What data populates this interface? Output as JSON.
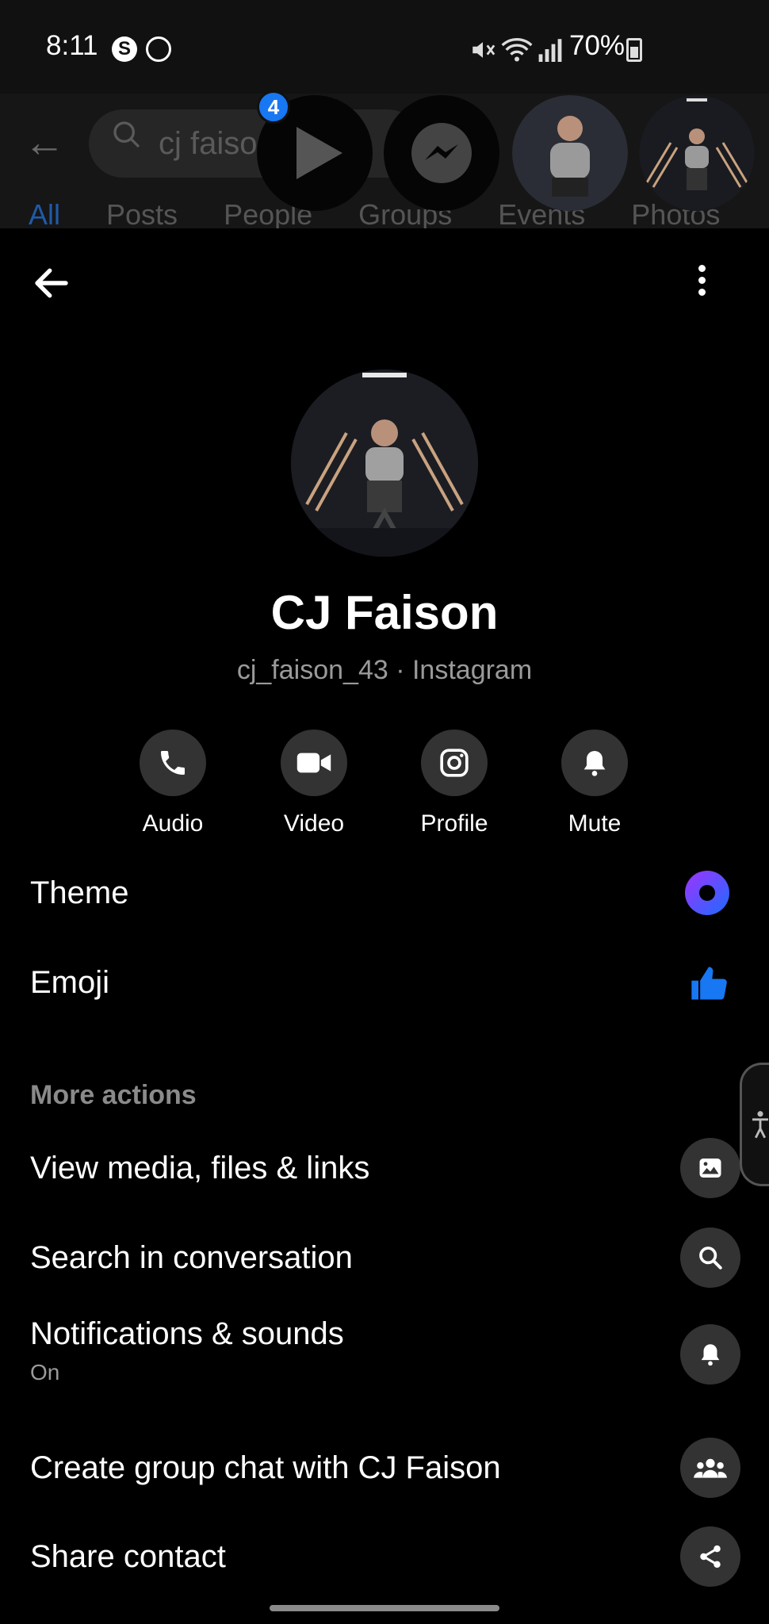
{
  "status_bar": {
    "time": "8:11",
    "battery": "70%",
    "app_icons": [
      "s-icon",
      "messenger-icon"
    ]
  },
  "background": {
    "search_text": "cj faiso",
    "tabs": [
      "All",
      "Posts",
      "People",
      "Groups",
      "Events",
      "Photos"
    ],
    "notification_badge": "4"
  },
  "header": {
    "back_icon": "back-arrow-icon",
    "more_icon": "more-vertical-icon"
  },
  "profile": {
    "name": "CJ Faison",
    "subtitle": "cj_faison_43 · Instagram"
  },
  "actions": [
    {
      "label": "Audio",
      "icon": "phone-icon"
    },
    {
      "label": "Video",
      "icon": "video-camera-icon"
    },
    {
      "label": "Profile",
      "icon": "instagram-icon"
    },
    {
      "label": "Mute",
      "icon": "bell-icon"
    }
  ],
  "settings": {
    "theme_label": "Theme",
    "theme_color": "#7b3cff",
    "emoji_label": "Emoji",
    "emoji_icon": "thumbs-up-icon",
    "emoji_color": "#1877f2"
  },
  "more_actions": {
    "title": "More actions",
    "items": [
      {
        "label": "View media, files & links",
        "icon": "image-icon"
      },
      {
        "label": "Search in conversation",
        "icon": "search-icon"
      },
      {
        "label": "Notifications & sounds",
        "sub": "On",
        "icon": "bell-icon"
      },
      {
        "label": "Create group chat with CJ Faison",
        "icon": "group-icon"
      },
      {
        "label": "Share contact",
        "icon": "share-icon"
      }
    ]
  }
}
